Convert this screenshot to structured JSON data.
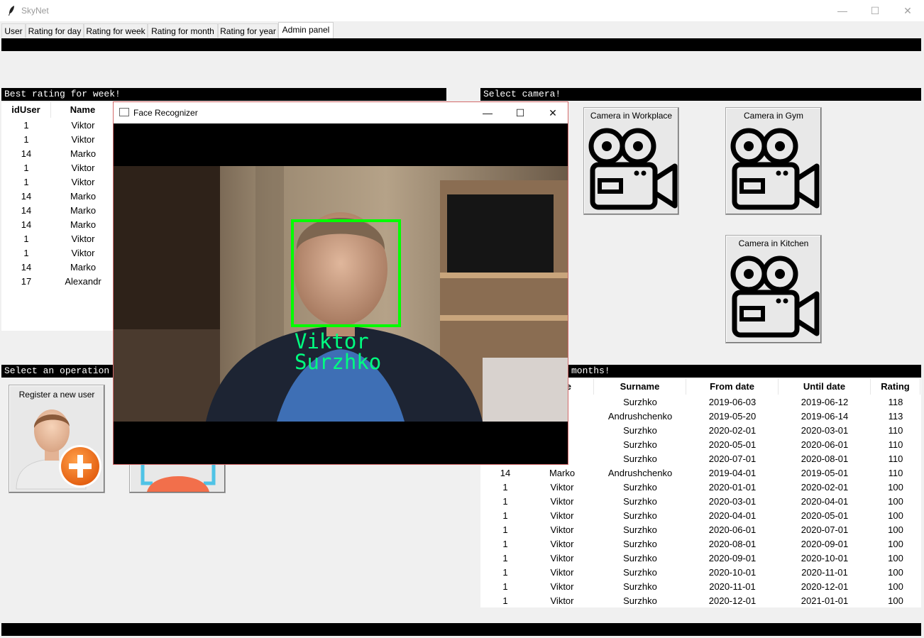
{
  "app": {
    "title": "SkyNet"
  },
  "window_controls": {
    "minimize": "—",
    "maximize": "☐",
    "close": "✕"
  },
  "tabs": [
    {
      "label": "User"
    },
    {
      "label": "Rating for day"
    },
    {
      "label": "Rating for week"
    },
    {
      "label": "Rating for month"
    },
    {
      "label": "Rating for year"
    },
    {
      "label": "Admin panel"
    }
  ],
  "best_week": {
    "label": "Best rating for week!",
    "headers": [
      "idUser",
      "Name"
    ],
    "rows": [
      [
        "1",
        "Viktor"
      ],
      [
        "1",
        "Viktor"
      ],
      [
        "14",
        "Marko"
      ],
      [
        "1",
        "Viktor"
      ],
      [
        "1",
        "Viktor"
      ],
      [
        "14",
        "Marko"
      ],
      [
        "14",
        "Marko"
      ],
      [
        "14",
        "Marko"
      ],
      [
        "1",
        "Viktor"
      ],
      [
        "1",
        "Viktor"
      ],
      [
        "14",
        "Marko"
      ],
      [
        "17",
        "Alexandr"
      ]
    ]
  },
  "cameras": {
    "label": "Select camera!",
    "buttons": [
      {
        "label": "Camera in Workplace",
        "icon": "video-camera-icon"
      },
      {
        "label": "Camera in Gym",
        "icon": "video-camera-icon"
      },
      {
        "label": "Camera in Kitchen",
        "icon": "video-camera-icon"
      }
    ]
  },
  "operations": {
    "label": "Select an operation",
    "register_label": "Register a new user"
  },
  "best_months": {
    "label": "months!",
    "headers": [
      "Surname",
      "From date",
      "Until date",
      "Rating"
    ],
    "partial_header": "e",
    "rows": [
      [
        "",
        "or",
        "Surzhko",
        "2019-06-03",
        "2019-06-12",
        "118"
      ],
      [
        "",
        "o",
        "Andrushchenko",
        "2019-05-20",
        "2019-06-14",
        "113"
      ],
      [
        "",
        "or",
        "Surzhko",
        "2020-02-01",
        "2020-03-01",
        "110"
      ],
      [
        "",
        "or",
        "Surzhko",
        "2020-05-01",
        "2020-06-01",
        "110"
      ],
      [
        "",
        "or",
        "Surzhko",
        "2020-07-01",
        "2020-08-01",
        "110"
      ],
      [
        "14",
        "Marko",
        "Andrushchenko",
        "2019-04-01",
        "2019-05-01",
        "110"
      ],
      [
        "1",
        "Viktor",
        "Surzhko",
        "2020-01-01",
        "2020-02-01",
        "100"
      ],
      [
        "1",
        "Viktor",
        "Surzhko",
        "2020-03-01",
        "2020-04-01",
        "100"
      ],
      [
        "1",
        "Viktor",
        "Surzhko",
        "2020-04-01",
        "2020-05-01",
        "100"
      ],
      [
        "1",
        "Viktor",
        "Surzhko",
        "2020-06-01",
        "2020-07-01",
        "100"
      ],
      [
        "1",
        "Viktor",
        "Surzhko",
        "2020-08-01",
        "2020-09-01",
        "100"
      ],
      [
        "1",
        "Viktor",
        "Surzhko",
        "2020-09-01",
        "2020-10-01",
        "100"
      ],
      [
        "1",
        "Viktor",
        "Surzhko",
        "2020-10-01",
        "2020-11-01",
        "100"
      ],
      [
        "1",
        "Viktor",
        "Surzhko",
        "2020-11-01",
        "2020-12-01",
        "100"
      ],
      [
        "1",
        "Viktor",
        "Surzhko",
        "2020-12-01",
        "2021-01-01",
        "100"
      ]
    ]
  },
  "face_window": {
    "title": "Face Recognizer",
    "name_line1": "Viktor",
    "name_line2": "Surzhko",
    "box_color": "#00ff00",
    "text_color": "#00ff80"
  }
}
